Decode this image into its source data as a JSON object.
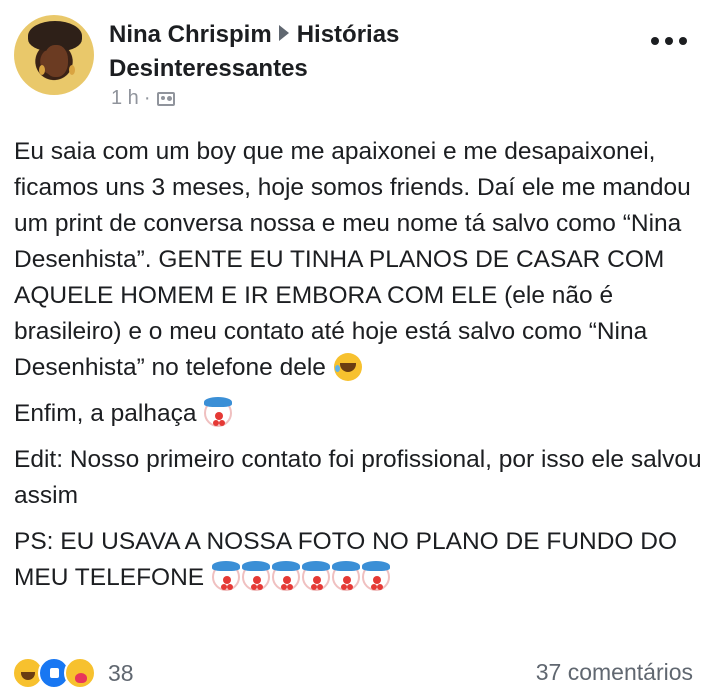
{
  "author": {
    "name": "Nina Chrispim",
    "group": "Histórias Desinteressantes",
    "time": "1 h",
    "separator": "·",
    "audience_icon": "group-members-icon"
  },
  "post": {
    "paragraph_1": "Eu saia com um boy que me apaixonei e me desapaixonei, ficamos uns 3 meses, hoje somos friends. Daí ele me mandou um print de conversa nossa e meu nome tá salvo como “Nina Desenhista”. GENTE EU TINHA PLANOS DE CASAR COM AQUELE HOMEM E IR EMBORA COM ELE (ele não é brasileiro) e o meu contato até hoje está salvo como “Nina Desenhista” no telefone dele",
    "paragraph_1_emoji": "rolling-on-floor-laughing-emoji",
    "paragraph_2": "Enfim, a palhaça",
    "paragraph_2_emoji": "clown-emoji",
    "paragraph_3": "Edit: Nosso primeiro contato foi profissional, por isso ele salvou assim",
    "paragraph_4": "PS: EU USAVA A NOSSA FOTO NO PLANO DE FUNDO DO MEU TELEFONE",
    "paragraph_4_emoji": "clown-emoji",
    "paragraph_4_emoji_count": 6
  },
  "footer": {
    "reaction_icons": [
      "haha-reaction-icon",
      "like-reaction-icon",
      "care-reaction-icon"
    ],
    "reaction_count": "38",
    "comments": "37 comentários"
  },
  "colors": {
    "text": "#1c1e21",
    "secondary": "#606770",
    "meta": "#90949c",
    "like_blue": "#1877f2"
  }
}
